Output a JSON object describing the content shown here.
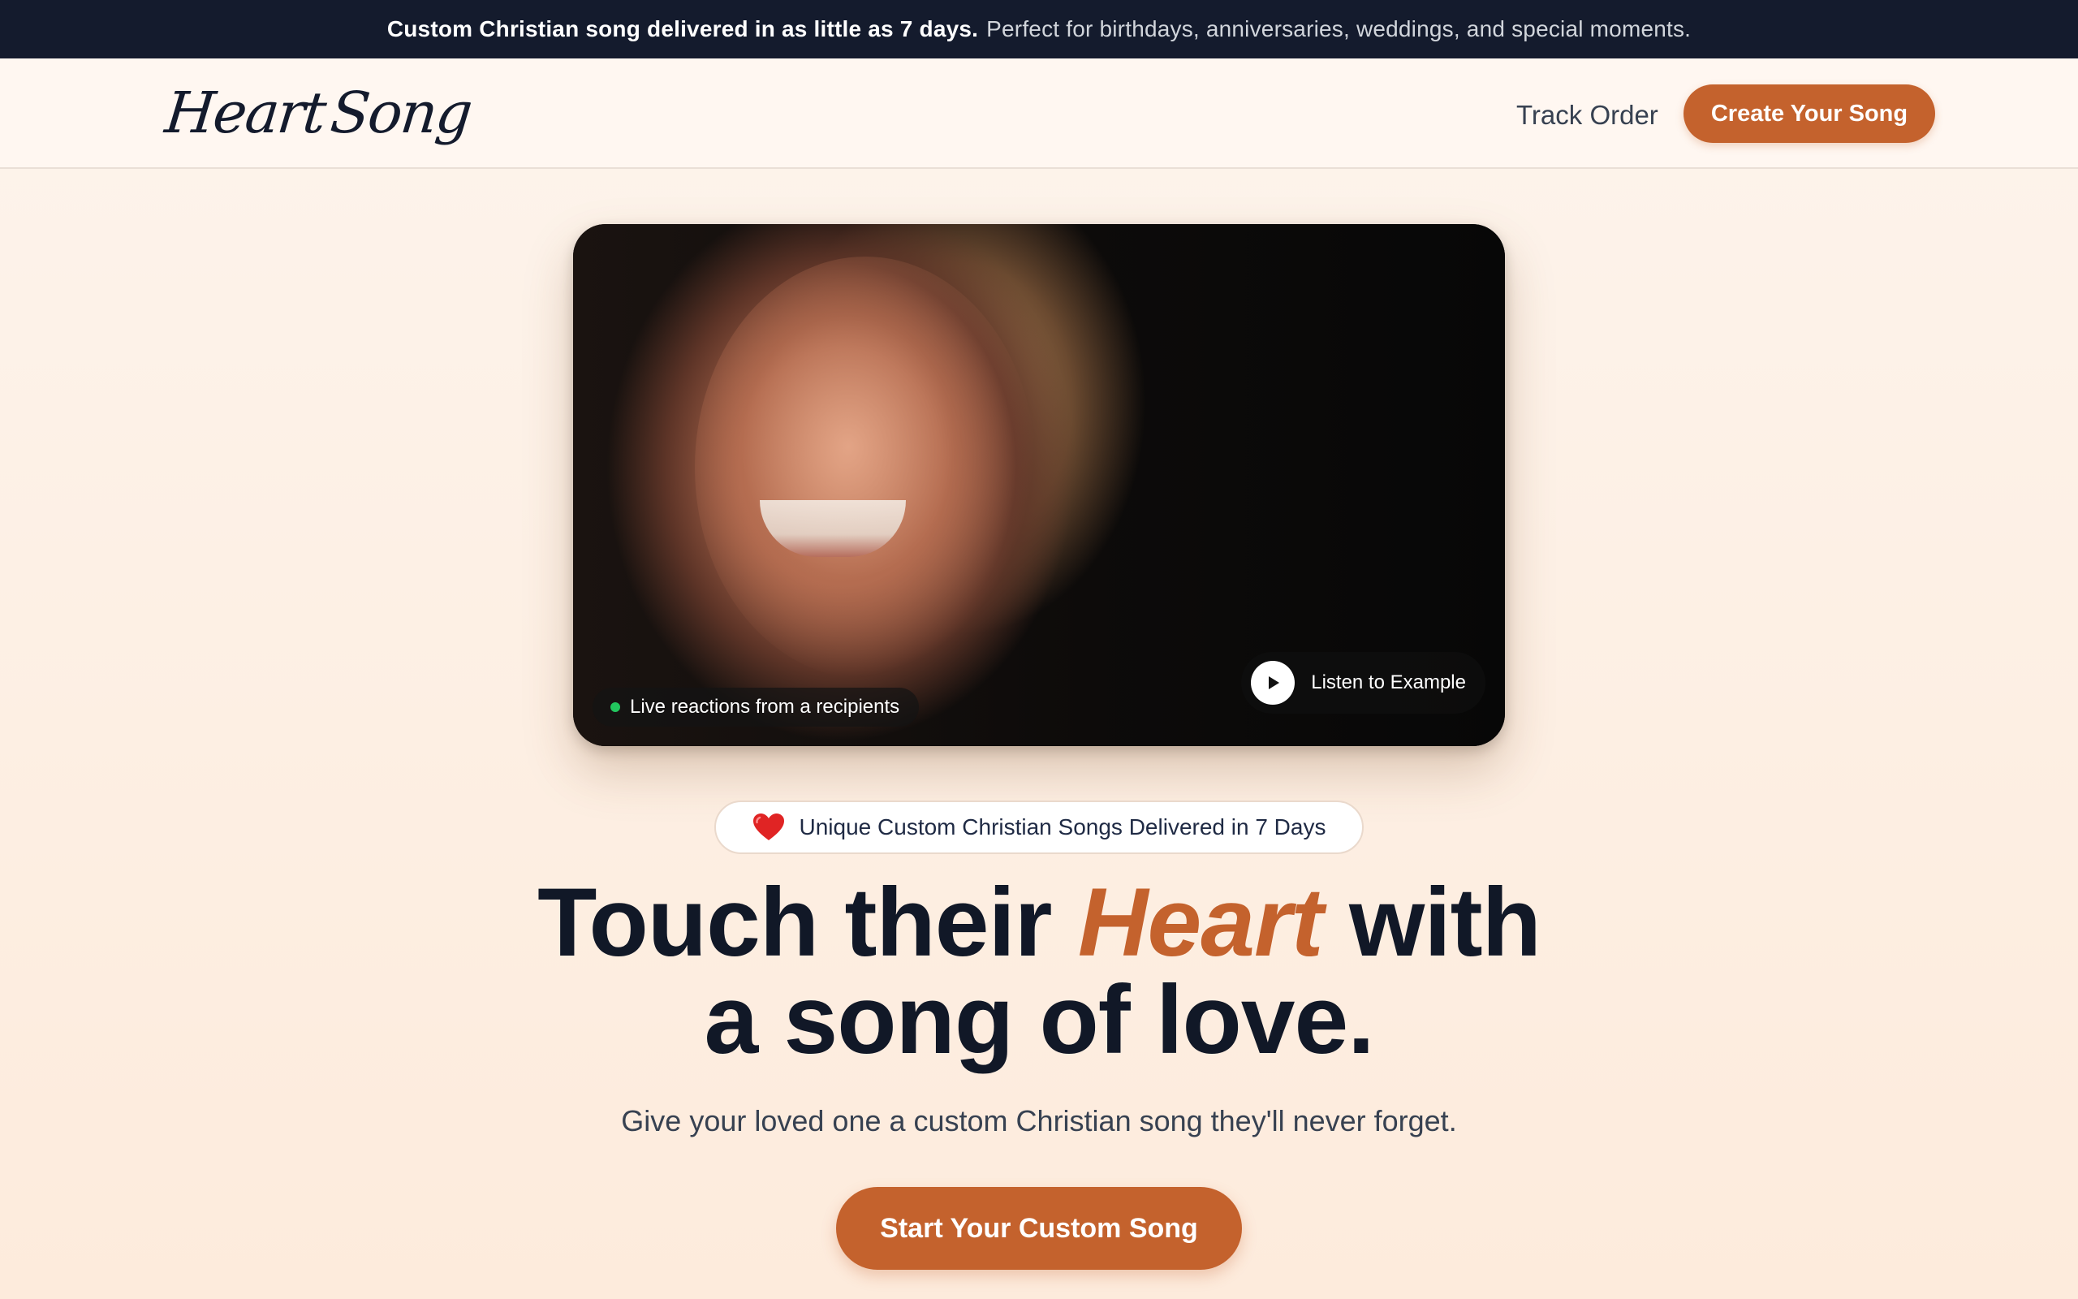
{
  "announcement": {
    "strong": "Custom Christian song delivered in as little as 7 days.",
    "rest": "Perfect for birthdays, anniversaries, weddings, and special moments."
  },
  "header": {
    "logo_heart": "Heart",
    "logo_song": "Song",
    "nav_track": "Track Order",
    "nav_create": "Create Your Song"
  },
  "video": {
    "live_label": "Live reactions from a recipients",
    "listen_label": "Listen to Example"
  },
  "badge": {
    "label": "Unique Custom Christian Songs Delivered in 7 Days"
  },
  "hero": {
    "headline_part1": "Touch their ",
    "headline_accent": "Heart",
    "headline_part2": " with",
    "headline_line2": "a song of love.",
    "subheadline": "Give your loved one a custom Christian song they'll never forget.",
    "cta": "Start Your Custom Song"
  },
  "colors": {
    "accent": "#c4622d",
    "dark": "#141b2d",
    "live_dot": "#22c55e"
  },
  "icons": {
    "play": "play-icon",
    "heart": "heart-icon",
    "live": "live-dot-icon"
  }
}
